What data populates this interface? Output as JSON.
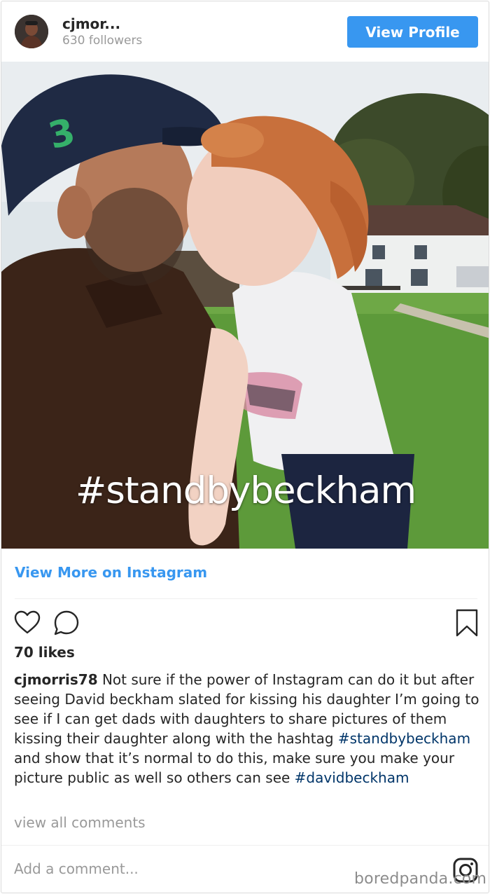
{
  "header": {
    "username": "cjmor...",
    "followers": "630 followers",
    "view_profile_label": "View Profile"
  },
  "photo": {
    "overlay_text": "#standbybeckham",
    "cap_number": "3"
  },
  "view_more_label": "View More on Instagram",
  "actions": {
    "like_icon": "heart-icon",
    "comment_icon": "comment-icon",
    "save_icon": "bookmark-icon"
  },
  "likes": "70 likes",
  "caption": {
    "username": "cjmorris78",
    "text_1": " Not sure if the power of Instagram can do it but after seeing David beckham slated for kissing his daughter I’m going to see if I can get dads with daughters to share pictures of them kissing their daughter along with the hashtag ",
    "hashtag_1": "#standbybeckham",
    "text_2": " and show that it’s normal to do this, make sure you make your picture public as well so others can see ",
    "hashtag_2": "#davidbeckham"
  },
  "view_comments_label": "view all comments",
  "comment_placeholder": "Add a comment...",
  "watermark": "boredpanda.com",
  "colors": {
    "accent": "#3897f0",
    "hashtag": "#003569",
    "muted": "#999999"
  }
}
